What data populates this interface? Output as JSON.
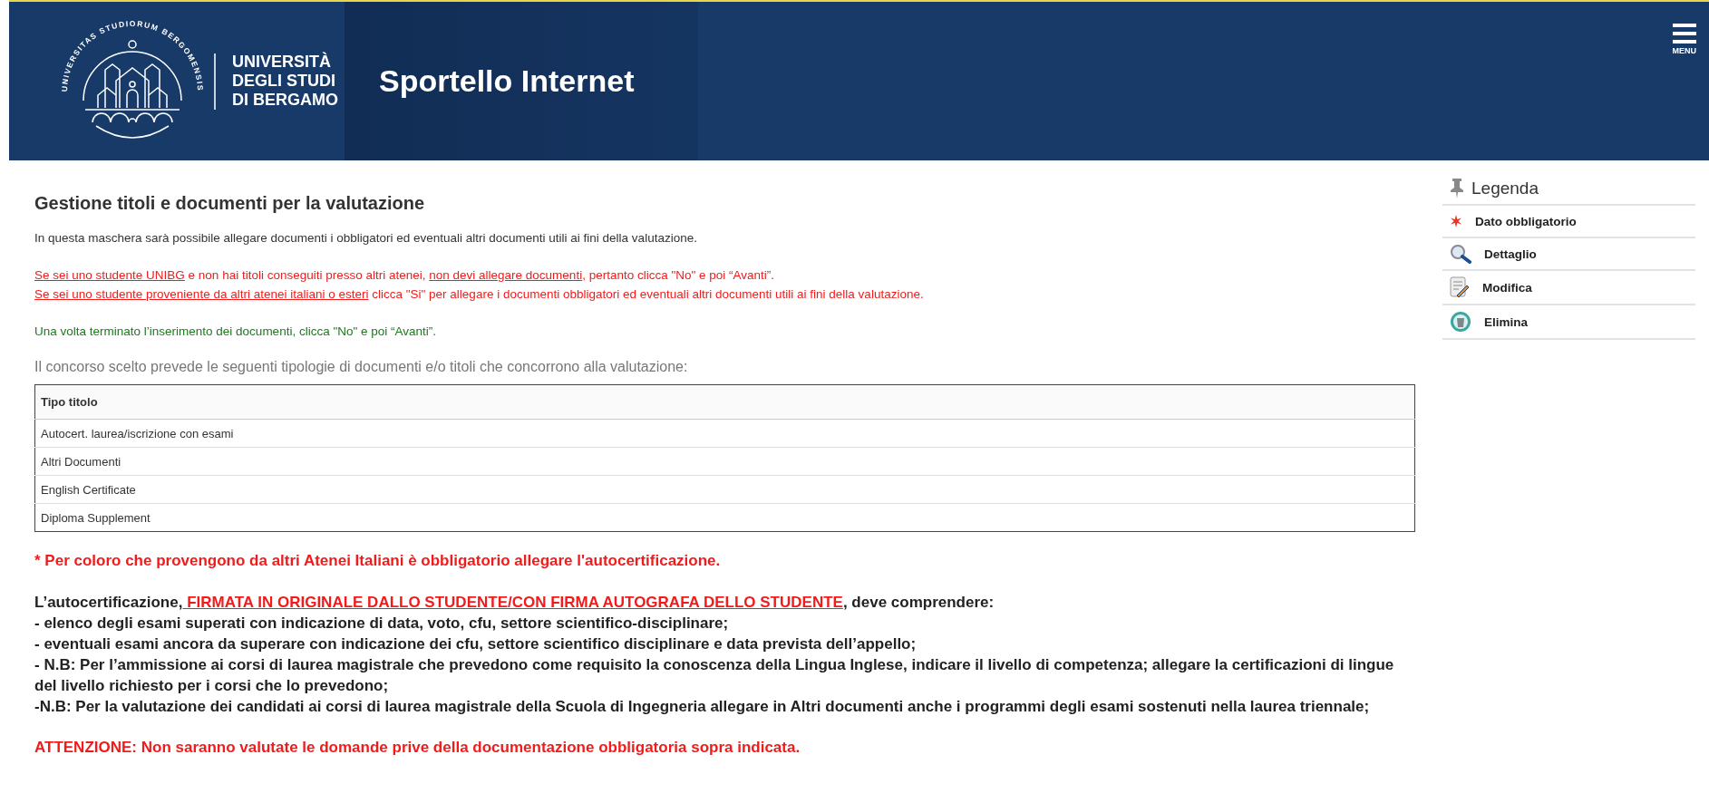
{
  "header": {
    "seal_text": "UNIVERSITAS STUDIORUM BERGOMENSIS",
    "logo_lines": [
      "UNIVERSITÀ",
      "DEGLI STUDI",
      "DI BERGAMO"
    ],
    "app_title": "Sportello Internet",
    "menu_label": "MENU"
  },
  "page": {
    "title": "Gestione titoli e documenti per la valutazione",
    "intro": "In questa maschera sarà possibile allegare documenti i obbligatori ed eventuali altri documenti utili ai fini della valutazione.",
    "notice_lines": [
      [
        {
          "text": "Se sei uno studente UNIBG",
          "link": true
        },
        {
          "text": " e non hai titoli conseguiti presso altri atenei, ",
          "link": false
        },
        {
          "text": "non devi allegare documenti",
          "link": true
        },
        {
          "text": ", pertanto clicca \"No\" e poi “Avanti”.",
          "link": false
        }
      ],
      [
        {
          "text": "Se sei uno studente proveniente da altri atenei italiani o esteri",
          "link": true
        },
        {
          "text": " clicca \"Si\" per allegare i documenti obbligatori ed eventuali altri documenti utili ai fini della valutazione.",
          "link": false
        }
      ]
    ],
    "done_note": "Una volta terminato l’inserimento dei documenti, clicca \"No\" e poi “Avanti”.",
    "types_intro": "Il concorso scelto prevede le seguenti tipologie di documenti e/o titoli che concorrono alla valutazione:"
  },
  "table": {
    "columns": [
      "Tipo titolo"
    ],
    "rows": [
      [
        "Autocert. laurea/iscrizione con esami"
      ],
      [
        "Altri Documenti"
      ],
      [
        "English Certificate"
      ],
      [
        "Diploma Supplement"
      ]
    ]
  },
  "required_note": "* Per coloro che provengono da altri Atenei Italiani è obbligatorio allegare l'autocertificazione.",
  "autocert": {
    "segments": [
      {
        "text": "L’autocertificazione,",
        "link": false
      },
      {
        "text": " FIRMATA IN ORIGINALE DALLO STUDENTE/CON FIRMA AUTOGRAFA DELLO STUDENTE",
        "link": true
      },
      {
        "text": ", deve comprendere:",
        "link": false
      }
    ],
    "items": [
      "- elenco degli esami superati con indicazione di data, voto, cfu, settore scientifico-disciplinare;",
      "- eventuali esami ancora da superare con indicazione dei cfu, settore scientifico disciplinare e data prevista dell’appello;",
      "- N.B: Per l’ammissione ai corsi di laurea magistrale che prevedono come requisito la conoscenza della Lingua Inglese, indicare il livello di competenza; allegare la certificazioni di lingue del livello richiesto per i corsi che lo prevedono;",
      "-N.B: Per la valutazione dei candidati ai corsi di laurea magistrale della Scuola di Ingegneria allegare in Altri documenti anche i programmi degli esami sostenuti nella laurea triennale;"
    ]
  },
  "warning": "ATTENZIONE: Non saranno valutate le domande prive della documentazione obbligatoria sopra indicata.",
  "legend": {
    "title": "Legenda",
    "items": [
      {
        "kind": "required",
        "label": "Dato obbligatorio"
      },
      {
        "kind": "detail",
        "label": "Dettaglio"
      },
      {
        "kind": "edit",
        "label": "Modifica"
      },
      {
        "kind": "delete",
        "label": "Elimina"
      }
    ]
  }
}
